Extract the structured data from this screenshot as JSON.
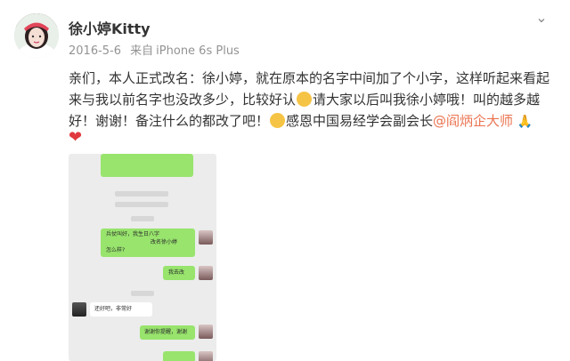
{
  "post": {
    "author": "徐小婷Kitty",
    "date": "2016-5-6",
    "source_prefix": "来自",
    "source": "iPhone 6s Plus",
    "text_part1": "亲们，本人正式改名：徐小婷，就在原本的名字中间加了个小字，这样听起来看起来与我以前名字也没改多少，比较好认",
    "text_part2": "请大家以后叫我徐小婷哦！叫的越多越好！谢谢！备注什么的都改了吧！",
    "text_part3": "感恩中国易经学会副会长",
    "mention": "@阎炳企大师",
    "pray_glyph": "🙏",
    "heart_glyph": "❤",
    "menu_glyph": "⌄"
  },
  "chat_image": {
    "bubble1": "兵仗叫好，我生日八字",
    "bubble1b": "改名徐小婷",
    "bubble1c": "怎么样?",
    "bubble2": "我去改",
    "bubble3": "还好吧，非常好",
    "bubble4": "谢谢你提醒，谢谢"
  },
  "colors": {
    "mention": "#eb7350",
    "chat_green": "#98e46d",
    "heart": "#e0393e"
  }
}
